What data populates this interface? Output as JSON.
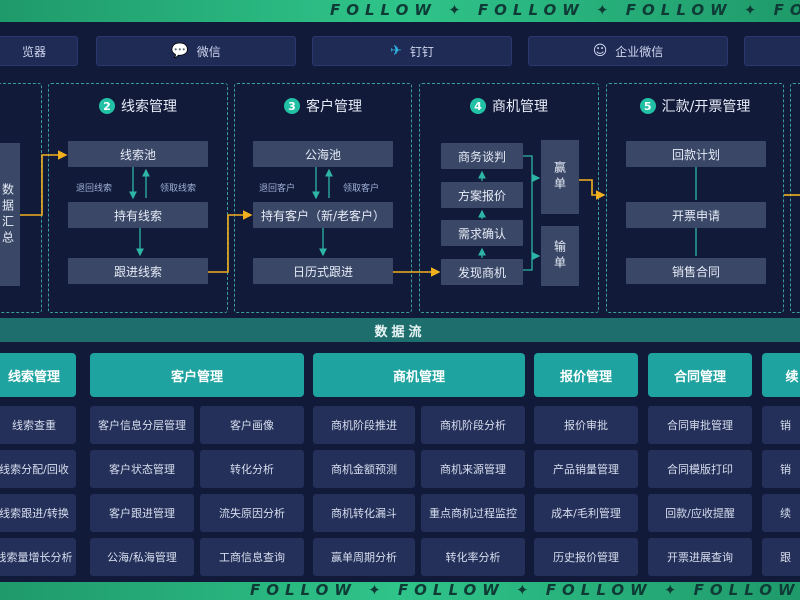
{
  "banner": {
    "text": "FOLLOW ✦ FOLLOW ✦ FOLLOW ✦ FOLLOW ✦ FOLLOW"
  },
  "channels": [
    {
      "label": "览器",
      "icon": ""
    },
    {
      "label": "微信",
      "icon": "💬"
    },
    {
      "label": "钉钉",
      "icon": "✈"
    },
    {
      "label": "企业微信",
      "icon": "☺"
    },
    {
      "label": "",
      "icon": ""
    }
  ],
  "sections": {
    "s1": {
      "side_label": "数据汇总"
    },
    "s2": {
      "num": "2",
      "title": "线索管理",
      "pool": "线索池",
      "back": "退回线索",
      "take": "领取线索",
      "hold": "持有线索",
      "follow": "跟进线索"
    },
    "s3": {
      "num": "3",
      "title": "客户管理",
      "pool": "公海池",
      "back": "退回客户",
      "take": "领取客户",
      "hold": "持有客户（新/老客户）",
      "follow": "日历式跟进"
    },
    "s4": {
      "num": "4",
      "title": "商机管理",
      "negotiate": "商务谈判",
      "quote": "方案报价",
      "confirm": "需求确认",
      "discover": "发现商机",
      "win": "赢单",
      "lose": "输单"
    },
    "s5": {
      "num": "5",
      "title": "汇款/开票管理",
      "plan": "回款计划",
      "invoice": "开票申请",
      "contract": "销售合同"
    }
  },
  "dataflow": {
    "label": "数据流"
  },
  "categories": [
    {
      "title": "线索管理",
      "items": [
        "线索查重",
        "线索分配/回收",
        "线索跟进/转换",
        "线索量增长分析"
      ]
    },
    {
      "title": "客户管理",
      "items": [
        "客户信息分层管理",
        "客户画像",
        "客户状态管理",
        "转化分析",
        "客户跟进管理",
        "流失原因分析",
        "公海/私海管理",
        "工商信息查询"
      ]
    },
    {
      "title": "商机管理",
      "items": [
        "商机阶段推进",
        "商机阶段分析",
        "商机金额预测",
        "商机来源管理",
        "商机转化漏斗",
        "重点商机过程监控",
        "赢单周期分析",
        "转化率分析"
      ]
    },
    {
      "title": "报价管理",
      "items": [
        "报价审批",
        "产品销量管理",
        "成本/毛利管理",
        "历史报价管理"
      ]
    },
    {
      "title": "合同管理",
      "items": [
        "合同审批管理",
        "合同模版打印",
        "回款/应收提醒",
        "开票进展查询"
      ]
    },
    {
      "title": "续",
      "items": [
        "销",
        "销",
        "续",
        "跟"
      ]
    }
  ],
  "colors": {
    "background": "#121a3a",
    "accent": "#1fa3a0",
    "arrow": "#f2b01e",
    "node": "#3a4766"
  }
}
